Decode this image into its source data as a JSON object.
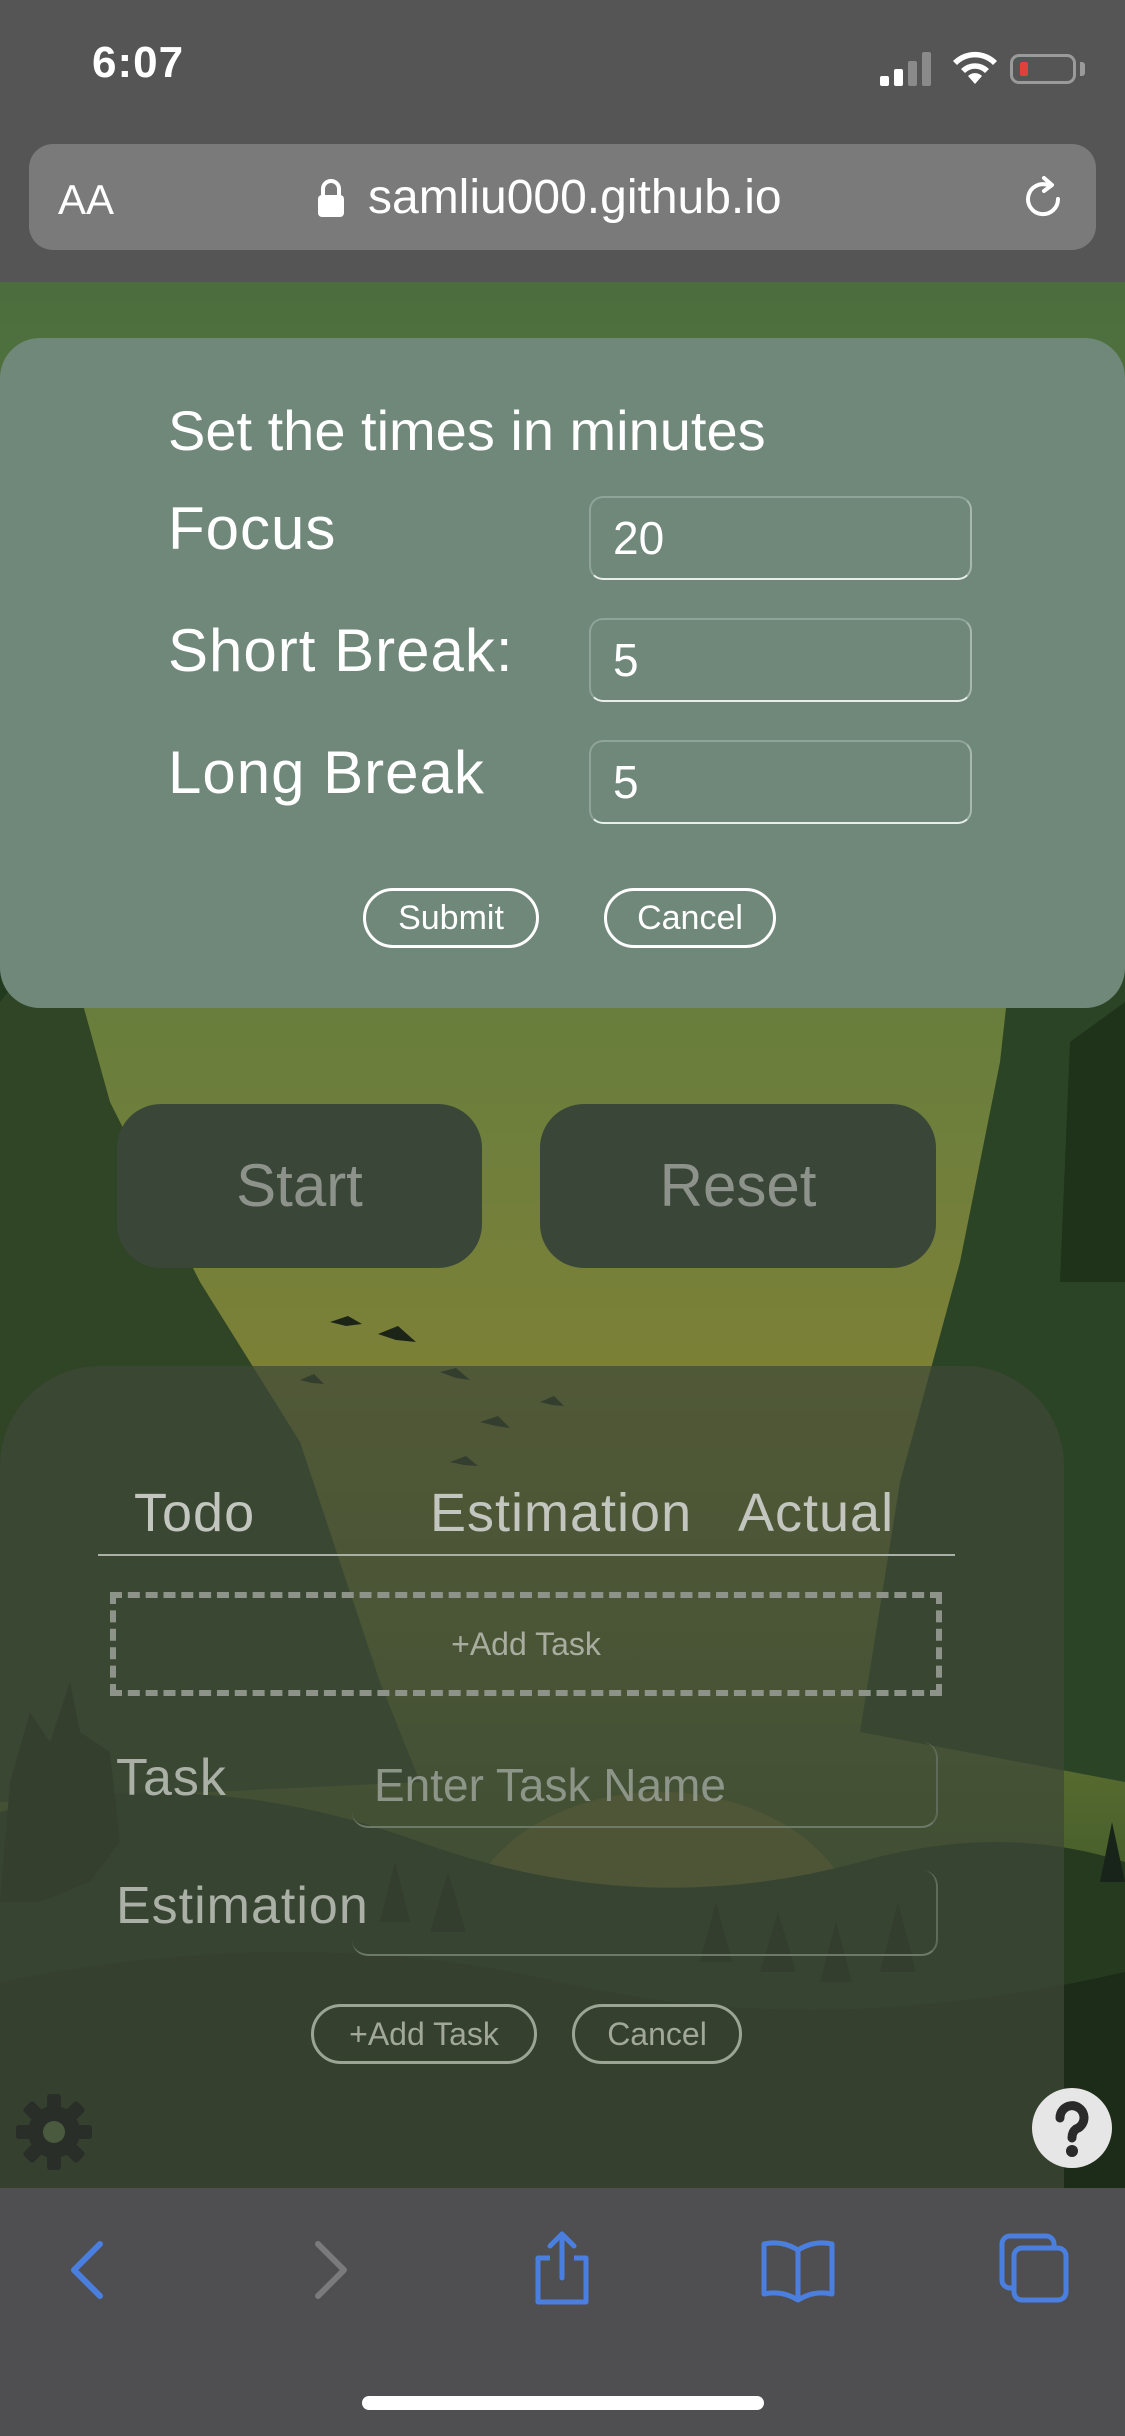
{
  "status_bar": {
    "time": "6:07"
  },
  "browser": {
    "text_size_label": "AA",
    "url": "samliu000.github.io"
  },
  "settings_modal": {
    "title": "Set the times in minutes",
    "focus_label": "Focus",
    "focus_value": "20",
    "short_break_label": "Short Break:",
    "short_break_value": "5",
    "long_break_label": "Long Break",
    "long_break_value": "5",
    "submit_label": "Submit",
    "cancel_label": "Cancel"
  },
  "timer_controls": {
    "start_label": "Start",
    "reset_label": "Reset"
  },
  "task_panel": {
    "headers": [
      "Todo",
      "Estimation",
      "Actual"
    ],
    "add_task_box_label": "+Add Task",
    "task_label": "Task",
    "task_placeholder": "Enter Task Name",
    "estimation_label": "Estimation",
    "add_task_button_label": "+Add Task",
    "cancel_button_label": "Cancel"
  },
  "icons": {
    "settings": "gear-icon",
    "help": "help-icon",
    "back": "back-icon",
    "forward": "forward-icon",
    "share": "share-icon",
    "bookmarks": "bookmarks-icon",
    "tabs": "tabs-icon"
  },
  "colors": {
    "toolbar_accent": "#4a7fe0",
    "modal_bg": "#70887a"
  }
}
